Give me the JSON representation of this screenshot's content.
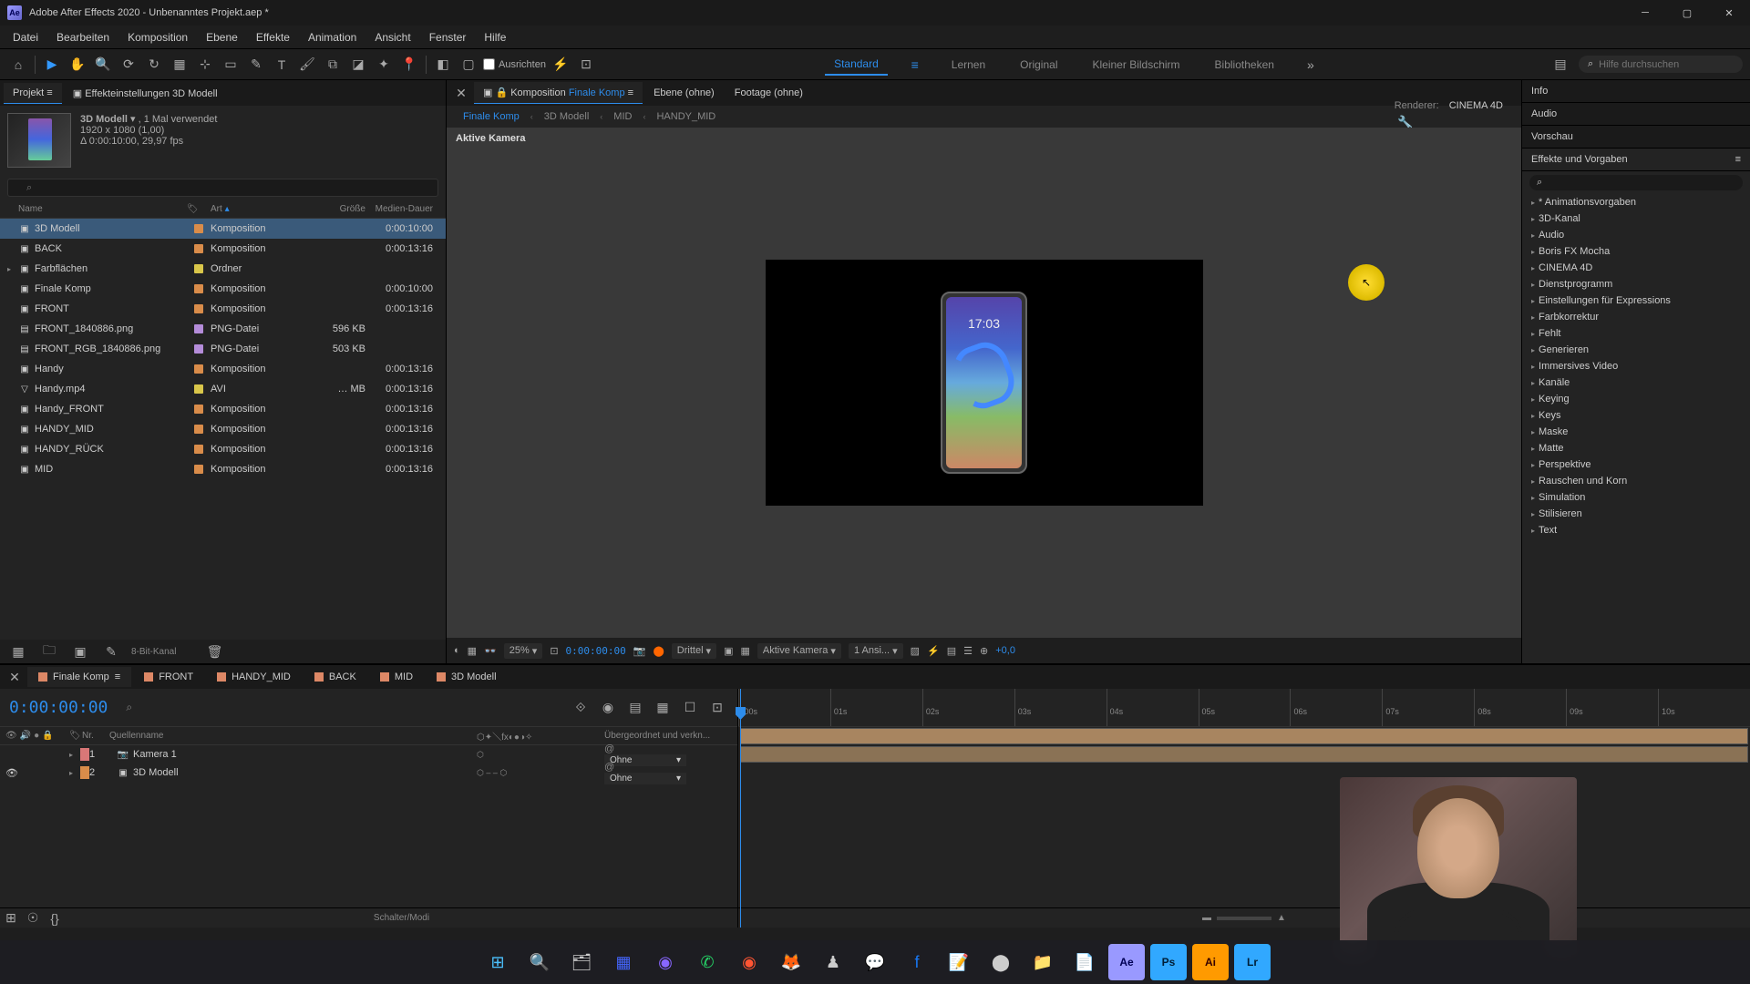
{
  "titlebar": {
    "title": "Adobe After Effects 2020 - Unbenanntes Projekt.aep *"
  },
  "menu": [
    "Datei",
    "Bearbeiten",
    "Komposition",
    "Ebene",
    "Effekte",
    "Animation",
    "Ansicht",
    "Fenster",
    "Hilfe"
  ],
  "toolbar": {
    "snap_label": "Ausrichten",
    "workspaces": [
      "Standard",
      "Lernen",
      "Original",
      "Kleiner Bildschirm",
      "Bibliotheken"
    ],
    "search_placeholder": "Hilfe durchsuchen"
  },
  "project": {
    "tabs": {
      "project": "Projekt",
      "effect_controls": "Effekteinstellungen 3D Modell"
    },
    "selected_name": "3D Modell",
    "selected_usage": ", 1 Mal verwendet",
    "res": "1920 x 1080 (1,00)",
    "dur": "Δ 0:00:10:00, 29,97 fps",
    "cols": {
      "name": "Name",
      "type": "Art",
      "size": "Größe",
      "mediadur": "Medien-Dauer"
    },
    "items": [
      {
        "name": "3D Modell",
        "type": "Komposition",
        "size": "",
        "dur": "0:00:10:00",
        "color": "#d98c4a",
        "sel": true,
        "icon": "▣"
      },
      {
        "name": "BACK",
        "type": "Komposition",
        "size": "",
        "dur": "0:00:13:16",
        "color": "#d98c4a",
        "icon": "▣"
      },
      {
        "name": "Farbflächen",
        "type": "Ordner",
        "size": "",
        "dur": "",
        "color": "#d9c64a",
        "icon": "▣"
      },
      {
        "name": "Finale Komp",
        "type": "Komposition",
        "size": "",
        "dur": "0:00:10:00",
        "color": "#d98c4a",
        "icon": "▣"
      },
      {
        "name": "FRONT",
        "type": "Komposition",
        "size": "",
        "dur": "0:00:13:16",
        "color": "#d98c4a",
        "icon": "▣"
      },
      {
        "name": "FRONT_1840886.png",
        "type": "PNG-Datei",
        "size": "596 KB",
        "dur": "",
        "color": "#b48cd9",
        "icon": "▤"
      },
      {
        "name": "FRONT_RGB_1840886.png",
        "type": "PNG-Datei",
        "size": "503 KB",
        "dur": "",
        "color": "#b48cd9",
        "icon": "▤"
      },
      {
        "name": "Handy",
        "type": "Komposition",
        "size": "",
        "dur": "0:00:13:16",
        "color": "#d98c4a",
        "icon": "▣"
      },
      {
        "name": "Handy.mp4",
        "type": "AVI",
        "size": "… MB",
        "dur": "0:00:13:16",
        "color": "#d9c64a",
        "icon": "▽"
      },
      {
        "name": "Handy_FRONT",
        "type": "Komposition",
        "size": "",
        "dur": "0:00:13:16",
        "color": "#d98c4a",
        "icon": "▣"
      },
      {
        "name": "HANDY_MID",
        "type": "Komposition",
        "size": "",
        "dur": "0:00:13:16",
        "color": "#d98c4a",
        "icon": "▣"
      },
      {
        "name": "HANDY_RÜCK",
        "type": "Komposition",
        "size": "",
        "dur": "0:00:13:16",
        "color": "#d98c4a",
        "icon": "▣"
      },
      {
        "name": "MID",
        "type": "Komposition",
        "size": "",
        "dur": "0:00:13:16",
        "color": "#d98c4a",
        "icon": "▣"
      }
    ],
    "footer_depth": "8-Bit-Kanal"
  },
  "comp": {
    "tabs": {
      "comp_prefix": "Komposition",
      "comp_name": "Finale Komp",
      "layer": "Ebene (ohne)",
      "footage": "Footage (ohne)"
    },
    "crumbs": [
      "Finale Komp",
      "3D Modell",
      "MID",
      "HANDY_MID"
    ],
    "renderer_label": "Renderer:",
    "renderer_value": "CINEMA 4D",
    "camera_label": "Aktive Kamera",
    "phone_time": "17:03",
    "footer": {
      "zoom": "25%",
      "timecode": "0:00:00:00",
      "res": "Drittel",
      "camera": "Aktive Kamera",
      "views": "1 Ansi...",
      "exposure": "+0,0"
    }
  },
  "right": {
    "info": "Info",
    "audio": "Audio",
    "preview": "Vorschau",
    "effects_title": "Effekte und Vorgaben",
    "categories": [
      "* Animationsvorgaben",
      "3D-Kanal",
      "Audio",
      "Boris FX Mocha",
      "CINEMA 4D",
      "Dienstprogramm",
      "Einstellungen für Expressions",
      "Farbkorrektur",
      "Fehlt",
      "Generieren",
      "Immersives Video",
      "Kanäle",
      "Keying",
      "Keys",
      "Maske",
      "Matte",
      "Perspektive",
      "Rauschen und Korn",
      "Simulation",
      "Stilisieren",
      "Text"
    ]
  },
  "timeline": {
    "tabs": [
      "Finale Komp",
      "FRONT",
      "HANDY_MID",
      "BACK",
      "MID",
      "3D Modell"
    ],
    "timecode": "0:00:00:00",
    "cols": {
      "num": "Nr.",
      "source": "Quellenname",
      "parent": "Übergeordnet und verkn..."
    },
    "layers": [
      {
        "num": "1",
        "name": "Kamera 1",
        "color": "#d97777",
        "parent": "Ohne",
        "icon": "📷"
      },
      {
        "num": "2",
        "name": "3D Modell",
        "color": "#d98c4a",
        "parent": "Ohne",
        "icon": "▣"
      }
    ],
    "ticks": [
      ":00s",
      "01s",
      "02s",
      "03s",
      "04s",
      "05s",
      "06s",
      "07s",
      "08s",
      "09s",
      "10s"
    ],
    "footer": "Schalter/Modi"
  }
}
